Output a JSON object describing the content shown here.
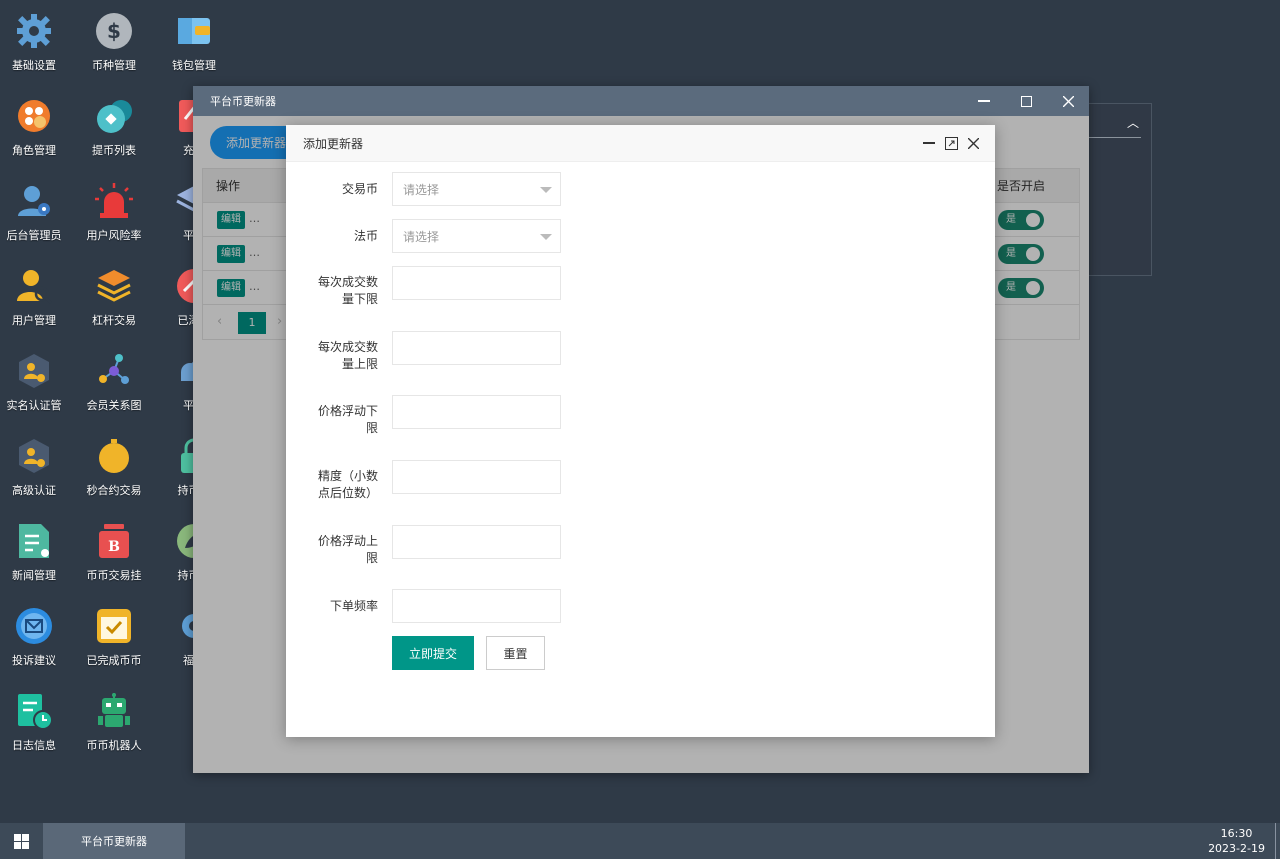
{
  "desktop_icons": [
    {
      "label": "基础设置",
      "icon": "gear-icon"
    },
    {
      "label": "币种管理",
      "icon": "dollar-coin-icon"
    },
    {
      "label": "钱包管理",
      "icon": "wallet-icon"
    },
    {
      "label": "角色管理",
      "icon": "role-icon"
    },
    {
      "label": "提币列表",
      "icon": "withdraw-list-icon"
    },
    {
      "label": "充币",
      "icon": "deposit-icon"
    },
    {
      "label": "后台管理员",
      "icon": "admin-icon"
    },
    {
      "label": "用户风险率",
      "icon": "alarm-icon"
    },
    {
      "label": "平台",
      "icon": "layers-icon"
    },
    {
      "label": "用户管理",
      "icon": "user-search-icon"
    },
    {
      "label": "杠杆交易",
      "icon": "stack-icon"
    },
    {
      "label": "已添加",
      "icon": "chart-circle-icon"
    },
    {
      "label": "实名认证管",
      "icon": "verify-badge-icon"
    },
    {
      "label": "会员关系图",
      "icon": "network-icon"
    },
    {
      "label": "平台",
      "icon": "cloud-icon"
    },
    {
      "label": "高级认证",
      "icon": "advanced-verify-icon"
    },
    {
      "label": "秒合约交易",
      "icon": "stopwatch-icon"
    },
    {
      "label": "持币生",
      "icon": "lock-icon"
    },
    {
      "label": "新闻管理",
      "icon": "news-doc-icon"
    },
    {
      "label": "币币交易挂",
      "icon": "bitcoin-bag-icon"
    },
    {
      "label": "持币生",
      "icon": "leaf-circle-icon"
    },
    {
      "label": "投诉建议",
      "icon": "mail-circle-icon"
    },
    {
      "label": "已完成币币",
      "icon": "checked-box-icon"
    },
    {
      "label": "福利",
      "icon": "gear-blue-icon"
    },
    {
      "label": "日志信息",
      "icon": "log-clock-icon"
    },
    {
      "label": "币币机器人",
      "icon": "robot-icon"
    }
  ],
  "window": {
    "title": "平台币更新器",
    "add_button": "添加更新器",
    "table": {
      "col_operation": "操作",
      "col_enabled": "是否开启",
      "rows": [
        {
          "edit": "编辑",
          "more": "…",
          "switch": "是"
        },
        {
          "edit": "编辑",
          "more": "…",
          "switch": "是"
        },
        {
          "edit": "编辑",
          "more": "…",
          "switch": "是"
        }
      ],
      "pager": {
        "prev": "‹",
        "current": "1",
        "next": "›"
      }
    }
  },
  "modal": {
    "title": "添加更新器",
    "fields": [
      {
        "label": "交易币",
        "type": "select",
        "placeholder": "请选择",
        "value": ""
      },
      {
        "label": "法币",
        "type": "select",
        "placeholder": "请选择",
        "value": ""
      },
      {
        "label": "每次成交数量下限",
        "type": "text",
        "value": ""
      },
      {
        "label": "每次成交数量上限",
        "type": "text",
        "value": ""
      },
      {
        "label": "价格浮动下限",
        "type": "text",
        "value": ""
      },
      {
        "label": "精度（小数点后位数）",
        "type": "text",
        "value": ""
      },
      {
        "label": "价格浮动上限",
        "type": "text",
        "value": ""
      },
      {
        "label": "下单频率",
        "type": "text",
        "value": ""
      }
    ],
    "submit": "立即提交",
    "reset": "重置"
  },
  "taskbar": {
    "active_task": "平台币更新器",
    "time": "16:30",
    "date": "2023-2-19"
  },
  "colors": {
    "desktop_bg": "#2f3a47",
    "accent_teal": "#009688",
    "button_blue": "#1e9fff",
    "titlebar": "#5b6b7d"
  }
}
